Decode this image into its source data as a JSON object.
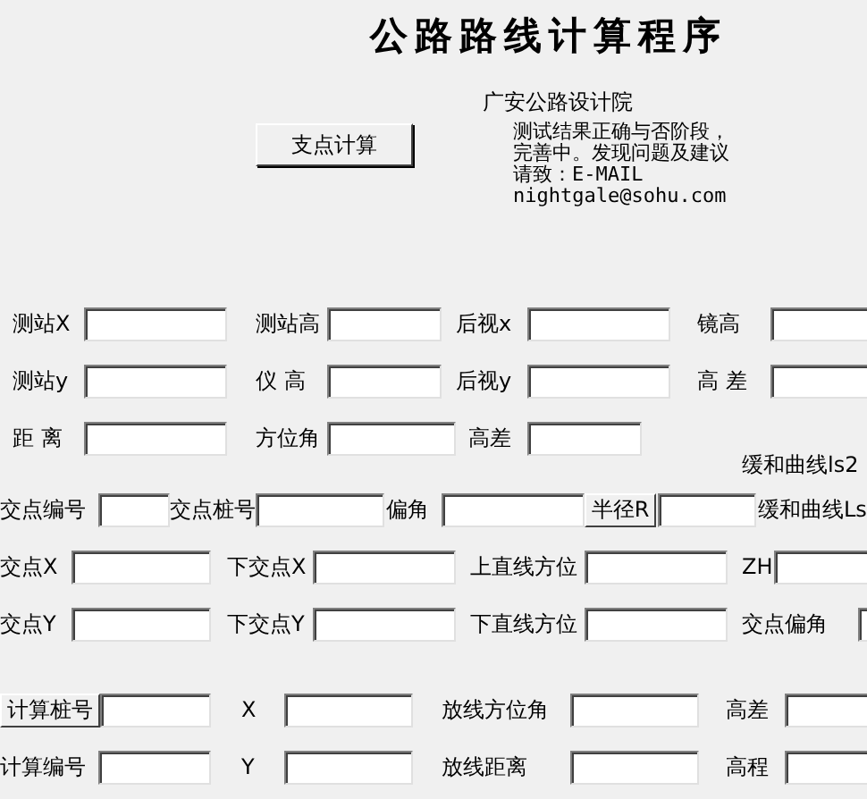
{
  "header": {
    "title": "公路路线计算程序",
    "subtitle": "广安公路设计院",
    "calc_button": "支点计算",
    "note_lines": [
      "测试结果正确与否阶段，",
      "完善中。发现问题及建议",
      "请致：E-MAIL",
      "nightgale@sohu.com"
    ]
  },
  "rows": [
    {
      "items": [
        {
          "kind": "label",
          "text": "测站X"
        },
        {
          "kind": "field"
        },
        {
          "kind": "label",
          "text": "测站高"
        },
        {
          "kind": "field"
        },
        {
          "kind": "label",
          "text": "后视x"
        },
        {
          "kind": "field"
        },
        {
          "kind": "label",
          "text": "镜高"
        },
        {
          "kind": "field"
        }
      ]
    },
    {
      "items": [
        {
          "kind": "label",
          "text": "测站y"
        },
        {
          "kind": "field"
        },
        {
          "kind": "label",
          "text": "仪 高"
        },
        {
          "kind": "field"
        },
        {
          "kind": "label",
          "text": "后视y"
        },
        {
          "kind": "field"
        },
        {
          "kind": "label",
          "text": "高 差"
        },
        {
          "kind": "field"
        }
      ]
    },
    {
      "items": [
        {
          "kind": "label",
          "text": "距 离"
        },
        {
          "kind": "field"
        },
        {
          "kind": "label",
          "text": "方位角"
        },
        {
          "kind": "field"
        },
        {
          "kind": "label",
          "text": "高差"
        },
        {
          "kind": "field"
        }
      ]
    },
    {
      "items": [
        {
          "kind": "label",
          "text": "缓和曲线ls2"
        }
      ]
    },
    {
      "items": [
        {
          "kind": "label",
          "text": "交点编号"
        },
        {
          "kind": "field"
        },
        {
          "kind": "label",
          "text": "交点桩号"
        },
        {
          "kind": "field"
        },
        {
          "kind": "label",
          "text": "偏角"
        },
        {
          "kind": "field"
        },
        {
          "kind": "button",
          "text": "半径R"
        },
        {
          "kind": "field"
        },
        {
          "kind": "label",
          "text": "缓和曲线Ls"
        }
      ]
    },
    {
      "items": [
        {
          "kind": "label",
          "text": "交点X"
        },
        {
          "kind": "field"
        },
        {
          "kind": "label",
          "text": "下交点X"
        },
        {
          "kind": "field"
        },
        {
          "kind": "label",
          "text": "上直线方位"
        },
        {
          "kind": "field"
        },
        {
          "kind": "label",
          "text": "ZH"
        },
        {
          "kind": "field"
        }
      ]
    },
    {
      "items": [
        {
          "kind": "label",
          "text": "交点Y"
        },
        {
          "kind": "field"
        },
        {
          "kind": "label",
          "text": "下交点Y"
        },
        {
          "kind": "field"
        },
        {
          "kind": "label",
          "text": "下直线方位"
        },
        {
          "kind": "field"
        },
        {
          "kind": "label",
          "text": "交点偏角"
        },
        {
          "kind": "field"
        }
      ]
    },
    {
      "items": [
        {
          "kind": "button",
          "text": "计算桩号"
        },
        {
          "kind": "field"
        },
        {
          "kind": "label",
          "text": "X"
        },
        {
          "kind": "field"
        },
        {
          "kind": "label",
          "text": "放线方位角"
        },
        {
          "kind": "field"
        },
        {
          "kind": "label",
          "text": "高差"
        },
        {
          "kind": "field"
        }
      ]
    },
    {
      "items": [
        {
          "kind": "label",
          "text": "计算编号"
        },
        {
          "kind": "field"
        },
        {
          "kind": "label",
          "text": "Y"
        },
        {
          "kind": "field"
        },
        {
          "kind": "label",
          "text": "放线距离"
        },
        {
          "kind": "field"
        },
        {
          "kind": "label",
          "text": "高程"
        },
        {
          "kind": "field"
        }
      ]
    }
  ]
}
